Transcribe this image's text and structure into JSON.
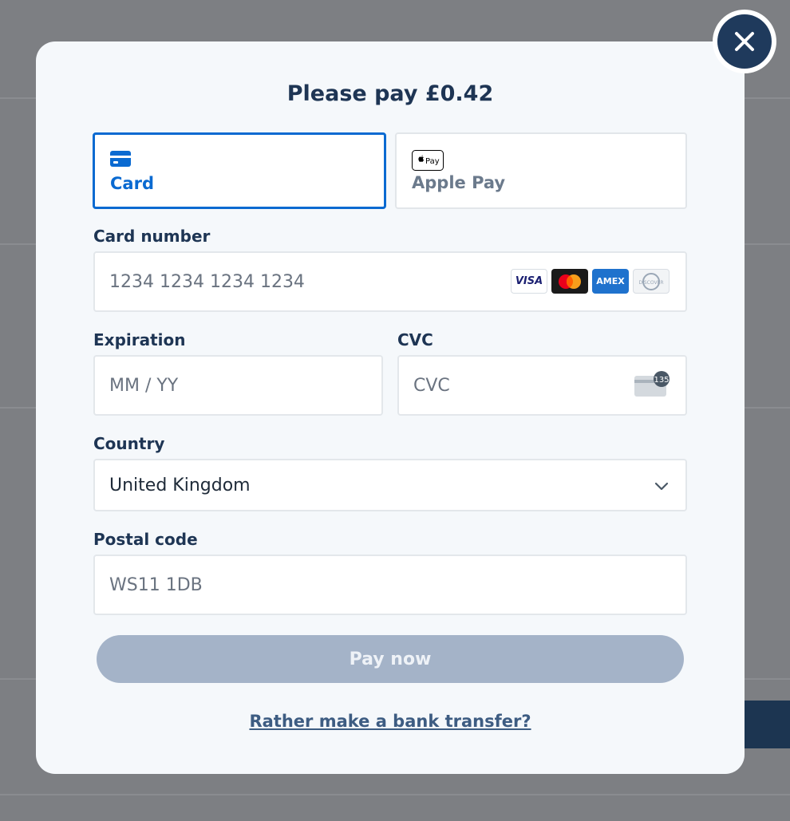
{
  "modal": {
    "title": "Please pay £0.42",
    "tabs": [
      {
        "label": "Card",
        "active": true,
        "icon": "card-icon"
      },
      {
        "label": "Apple Pay",
        "active": false,
        "icon": "apple-pay-icon",
        "badge": "Pay"
      }
    ],
    "card_number": {
      "label": "Card number",
      "placeholder": "1234 1234 1234 1234",
      "brands": [
        "VISA",
        "mastercard",
        "AMEX",
        "DISCOVER"
      ]
    },
    "expiration": {
      "label": "Expiration",
      "placeholder": "MM / YY"
    },
    "cvc": {
      "label": "CVC",
      "placeholder": "CVC",
      "icon_text": "135"
    },
    "country": {
      "label": "Country",
      "value": "United Kingdom"
    },
    "postal_code": {
      "label": "Postal code",
      "value": "WS11 1DB"
    },
    "pay_button": "Pay now",
    "bank_link": "Rather make a bank transfer?"
  },
  "colors": {
    "accent": "#0a6ad1",
    "navy": "#1e3554",
    "pay_button_disabled": "#a4b3c8",
    "overlay": "#7d7f83"
  }
}
